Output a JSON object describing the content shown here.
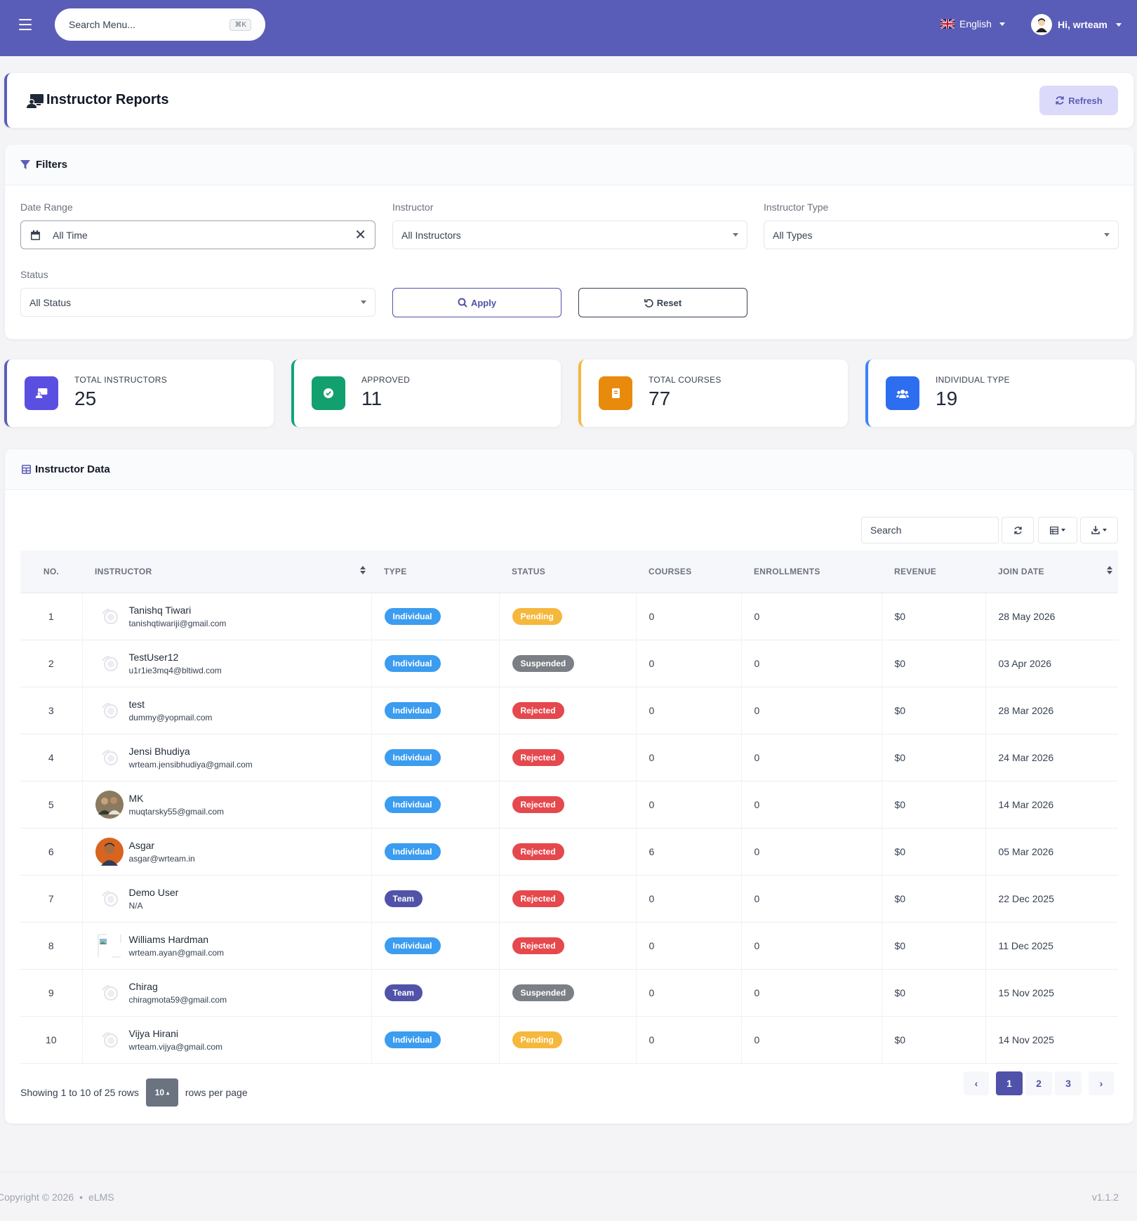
{
  "header": {
    "search_placeholder": "Search Menu...",
    "search_shortcut": "⌘K",
    "language": "English",
    "greeting": "Hi, wrteam"
  },
  "page": {
    "title": "Instructor Reports",
    "refresh_label": "Refresh"
  },
  "filters": {
    "title": "Filters",
    "date_range_label": "Date Range",
    "date_range_value": "All Time",
    "instructor_label": "Instructor",
    "instructor_value": "All Instructors",
    "type_label": "Instructor Type",
    "type_value": "All Types",
    "status_label": "Status",
    "status_value": "All Status",
    "apply_label": "Apply",
    "reset_label": "Reset"
  },
  "stats": [
    {
      "label": "TOTAL INSTRUCTORS",
      "value": "25",
      "color": "#5a5db8"
    },
    {
      "label": "APPROVED",
      "value": "11",
      "color": "#10a37f"
    },
    {
      "label": "TOTAL COURSES",
      "value": "77",
      "color": "#f59e0b"
    },
    {
      "label": "INDIVIDUAL TYPE",
      "value": "19",
      "color": "#3b82f6"
    }
  ],
  "table": {
    "title": "Instructor Data",
    "search_placeholder": "Search",
    "columns": [
      "NO.",
      "INSTRUCTOR",
      "TYPE",
      "STATUS",
      "COURSES",
      "ENROLLMENTS",
      "REVENUE",
      "JOIN DATE"
    ],
    "rows": [
      {
        "no": "1",
        "name": "Tanishq Tiwari",
        "email": "tanishqtiwariji@gmail.com",
        "type": "Individual",
        "status": "Pending",
        "courses": "0",
        "enrollments": "0",
        "revenue": "$0",
        "join_date": "28 May 2026",
        "avatar": "placeholder"
      },
      {
        "no": "2",
        "name": "TestUser12",
        "email": "u1r1ie3mq4@bltiwd.com",
        "type": "Individual",
        "status": "Suspended",
        "courses": "0",
        "enrollments": "0",
        "revenue": "$0",
        "join_date": "03 Apr 2026",
        "avatar": "placeholder"
      },
      {
        "no": "3",
        "name": "test",
        "email": "dummy@yopmail.com",
        "type": "Individual",
        "status": "Rejected",
        "courses": "0",
        "enrollments": "0",
        "revenue": "$0",
        "join_date": "28 Mar 2026",
        "avatar": "placeholder"
      },
      {
        "no": "4",
        "name": "Jensi Bhudiya",
        "email": "wrteam.jensibhudiya@gmail.com",
        "type": "Individual",
        "status": "Rejected",
        "courses": "0",
        "enrollments": "0",
        "revenue": "$0",
        "join_date": "24 Mar 2026",
        "avatar": "placeholder"
      },
      {
        "no": "5",
        "name": "MK",
        "email": "muqtarsky55@gmail.com",
        "type": "Individual",
        "status": "Rejected",
        "courses": "0",
        "enrollments": "0",
        "revenue": "$0",
        "join_date": "14 Mar 2026",
        "avatar": "photo-group"
      },
      {
        "no": "6",
        "name": "Asgar",
        "email": "asgar@wrteam.in",
        "type": "Individual",
        "status": "Rejected",
        "courses": "6",
        "enrollments": "0",
        "revenue": "$0",
        "join_date": "05 Mar 2026",
        "avatar": "photo-person"
      },
      {
        "no": "7",
        "name": "Demo User",
        "email": "N/A",
        "type": "Team",
        "status": "Rejected",
        "courses": "0",
        "enrollments": "0",
        "revenue": "$0",
        "join_date": "22 Dec 2025",
        "avatar": "placeholder"
      },
      {
        "no": "8",
        "name": "Williams Hardman",
        "email": "wrteam.ayan@gmail.com",
        "type": "Individual",
        "status": "Rejected",
        "courses": "0",
        "enrollments": "0",
        "revenue": "$0",
        "join_date": "11 Dec 2025",
        "avatar": "broken"
      },
      {
        "no": "9",
        "name": "Chirag",
        "email": "chiragmota59@gmail.com",
        "type": "Team",
        "status": "Suspended",
        "courses": "0",
        "enrollments": "0",
        "revenue": "$0",
        "join_date": "15 Nov 2025",
        "avatar": "placeholder"
      },
      {
        "no": "10",
        "name": "Vijya Hirani",
        "email": "wrteam.vijya@gmail.com",
        "type": "Individual",
        "status": "Pending",
        "courses": "0",
        "enrollments": "0",
        "revenue": "$0",
        "join_date": "14 Nov 2025",
        "avatar": "placeholder"
      }
    ],
    "summary": "Showing 1 to 10 of 25 rows",
    "page_size": "10",
    "rows_per_page_label": "rows per page",
    "pages": [
      "1",
      "2",
      "3"
    ],
    "current_page": "1",
    "prev_label": "‹",
    "next_label": "›"
  },
  "badge_colors": {
    "Individual": "#3b9cf0",
    "Team": "#5053a8",
    "Pending": "#f5b83d",
    "Suspended": "#7b7f86",
    "Rejected": "#e5484d"
  },
  "footer": {
    "copyright": "Copyright © 2026",
    "brand": "eLMS",
    "version": "v1.1.2"
  }
}
